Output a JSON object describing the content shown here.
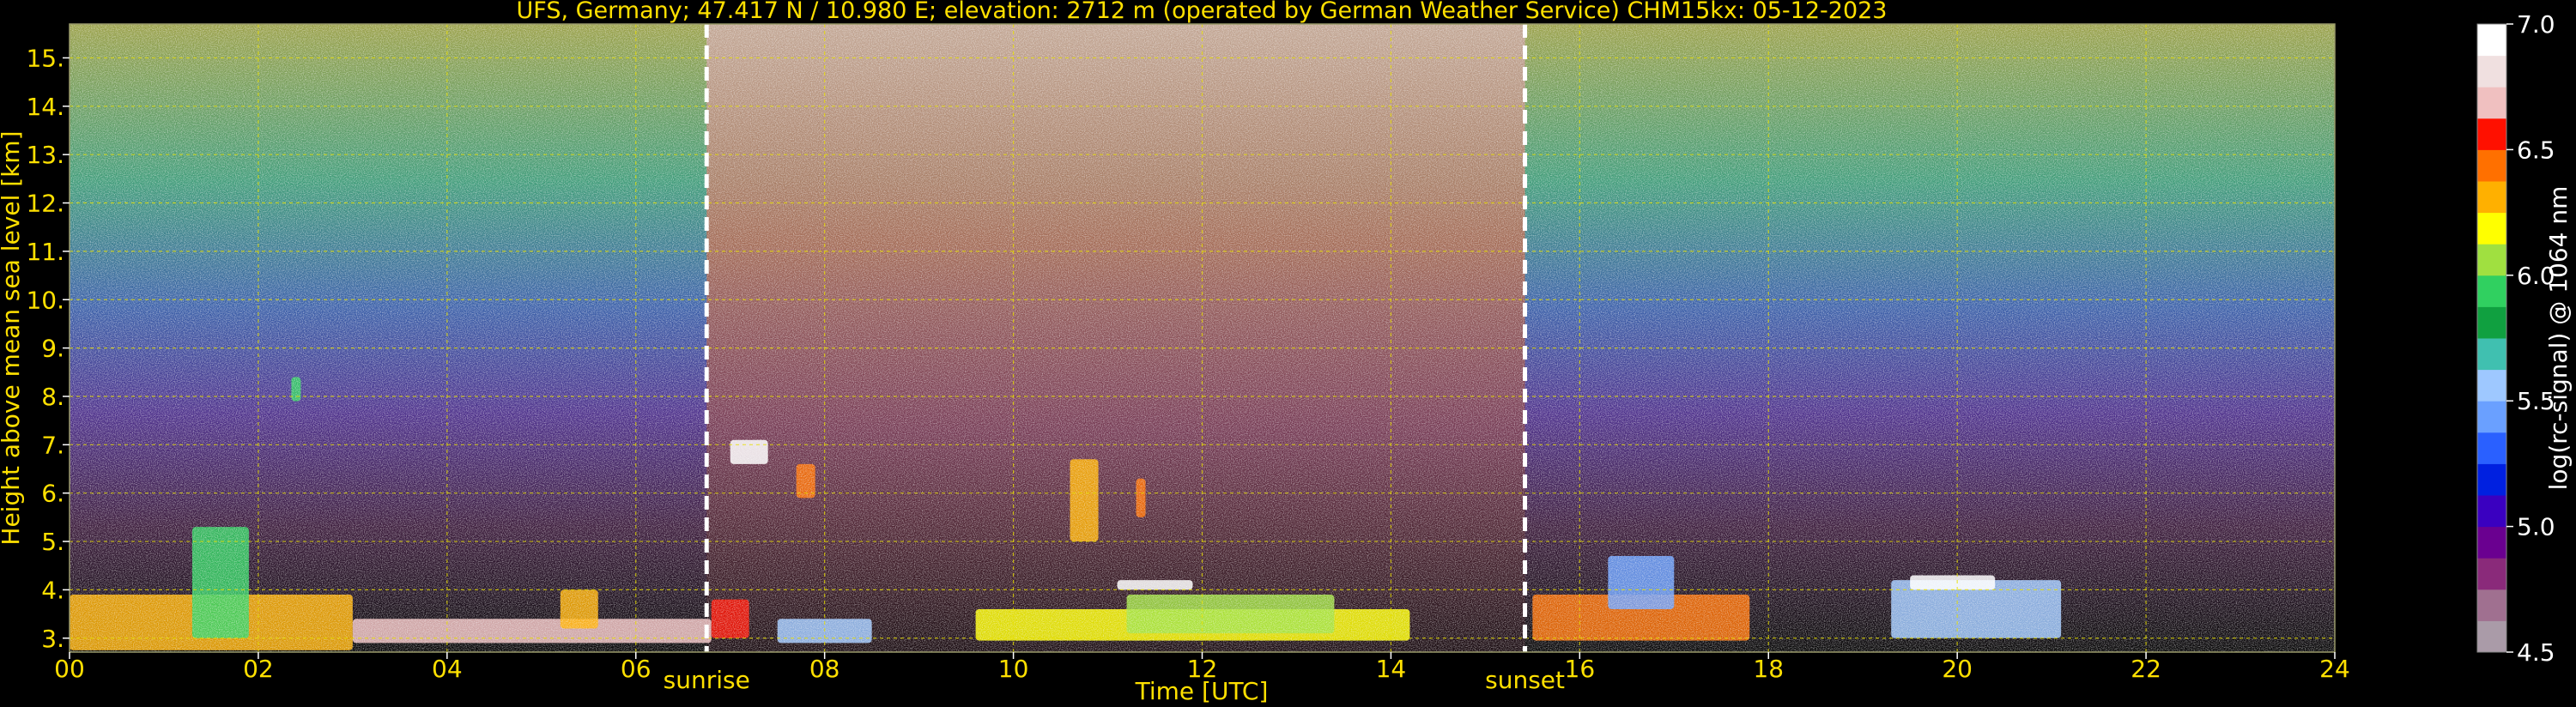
{
  "chart_data": {
    "type": "heatmap",
    "title": "UFS, Germany; 47.417 N / 10.980 E; elevation: 2712 m  (operated by German Weather Service)    CHM15kx: 05-12-2023",
    "xlabel": "Time [UTC]",
    "ylabel": "Height above mean sea level [km]",
    "xlim": [
      0,
      24
    ],
    "ylim": [
      2.712,
      15.7
    ],
    "x_ticks": [
      "00",
      "02",
      "04",
      "06",
      "08",
      "10",
      "12",
      "14",
      "16",
      "18",
      "20",
      "22",
      "24"
    ],
    "y_ticks": [
      "3.",
      "4.",
      "5.",
      "6.",
      "7.",
      "8.",
      "9.",
      "10.",
      "11.",
      "12.",
      "13.",
      "14.",
      "15."
    ],
    "grid": true,
    "markers": [
      {
        "name": "sunrise",
        "x": 6.75
      },
      {
        "name": "sunset",
        "x": 15.42
      }
    ],
    "colorbar": {
      "label": "log(rc-signal) @ 1064 nm",
      "range": [
        4.5,
        7.0
      ],
      "ticks": [
        "4.5",
        "5.0",
        "5.5",
        "6.0",
        "6.5",
        "7.0"
      ]
    },
    "features": [
      {
        "t0": 0.0,
        "t1": 3.0,
        "h0": 2.75,
        "h1": 3.9,
        "level": 6.3
      },
      {
        "t0": 1.3,
        "t1": 1.9,
        "h0": 3.0,
        "h1": 5.3,
        "level": 5.9
      },
      {
        "t0": 2.35,
        "t1": 2.45,
        "h0": 7.9,
        "h1": 8.4,
        "level": 5.9
      },
      {
        "t0": 3.0,
        "t1": 6.8,
        "h0": 2.9,
        "h1": 3.4,
        "level": 6.7
      },
      {
        "t0": 5.2,
        "t1": 5.6,
        "h0": 3.2,
        "h1": 4.0,
        "level": 6.3
      },
      {
        "t0": 6.8,
        "t1": 7.2,
        "h0": 3.0,
        "h1": 3.8,
        "level": 6.5
      },
      {
        "t0": 7.0,
        "t1": 7.4,
        "h0": 6.6,
        "h1": 7.1,
        "level": 6.9
      },
      {
        "t0": 7.7,
        "t1": 7.9,
        "h0": 5.9,
        "h1": 6.6,
        "level": 6.4
      },
      {
        "t0": 7.5,
        "t1": 8.5,
        "h0": 2.9,
        "h1": 3.4,
        "level": 5.6
      },
      {
        "t0": 9.6,
        "t1": 14.2,
        "h0": 2.95,
        "h1": 3.6,
        "level": 6.2
      },
      {
        "t0": 10.6,
        "t1": 10.9,
        "h0": 5.0,
        "h1": 6.7,
        "level": 6.3
      },
      {
        "t0": 11.3,
        "t1": 11.4,
        "h0": 5.5,
        "h1": 6.3,
        "level": 6.4
      },
      {
        "t0": 11.2,
        "t1": 13.4,
        "h0": 3.1,
        "h1": 3.9,
        "level": 6.0
      },
      {
        "t0": 11.1,
        "t1": 11.9,
        "h0": 4.0,
        "h1": 4.2,
        "level": 6.9
      },
      {
        "t0": 15.5,
        "t1": 17.8,
        "h0": 2.95,
        "h1": 3.9,
        "level": 6.4
      },
      {
        "t0": 16.3,
        "t1": 17.0,
        "h0": 3.6,
        "h1": 4.7,
        "level": 5.4
      },
      {
        "t0": 19.3,
        "t1": 21.1,
        "h0": 3.0,
        "h1": 4.2,
        "level": 5.6
      },
      {
        "t0": 19.5,
        "t1": 20.4,
        "h0": 4.0,
        "h1": 4.3,
        "level": 6.9
      }
    ]
  }
}
